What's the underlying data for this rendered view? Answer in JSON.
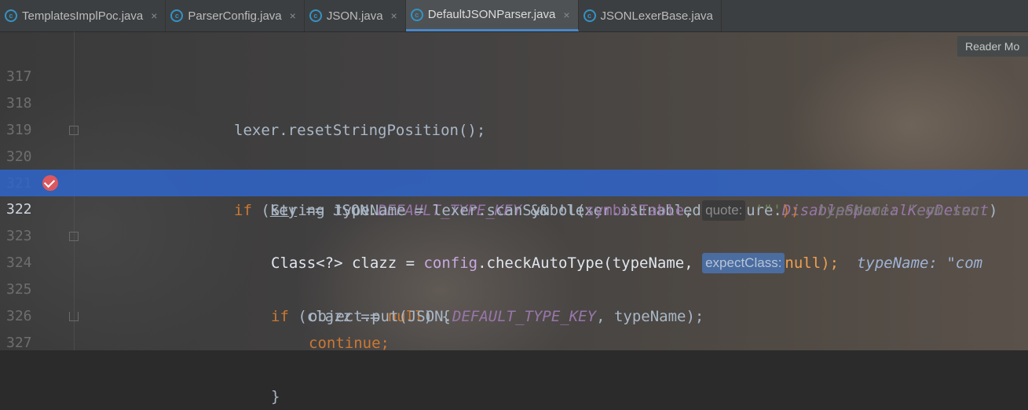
{
  "tabs": [
    {
      "label": "TemplatesImplPoc.java",
      "active": false,
      "close": "×"
    },
    {
      "label": "ParserConfig.java",
      "active": false,
      "close": "×"
    },
    {
      "label": "JSON.java",
      "active": false,
      "close": "×"
    },
    {
      "label": "DefaultJSONParser.java",
      "active": true,
      "close": "×"
    },
    {
      "label": "JSONLexerBase.java",
      "active": false,
      "close": ""
    }
  ],
  "tab_icon_letter": "c",
  "reader_mode": "Reader Mo",
  "colors": {
    "keyword": "#cc7832",
    "static_field": "#9876aa",
    "string": "#6a8759",
    "highlight": "#2f65ca",
    "breakpoint": "#db5860"
  },
  "lines": {
    "l317": {
      "num": "317"
    },
    "l318": {
      "num": "318",
      "text": "lexer.resetStringPosition();"
    },
    "l319": {
      "num": "319"
    },
    "l320": {
      "num": "320",
      "kw_if": "if",
      "paren": " (",
      "key": "key",
      "mid": " == JSON.",
      "const": "DEFAULT_TYPE_KEY",
      "mid2": " && !lexer.isEnabled(Feature.",
      "const2": "DisableSpecialKeyDetect",
      "end": ")"
    },
    "l321": {
      "num": "321",
      "pre": "String typeName = lexer.scanSymbol(",
      "field": "symbolTable",
      "comma": ", ",
      "hint": "quote:",
      "str": "'\"'",
      "end": ");",
      "debug": "typeName: \"com.sun."
    },
    "l322": {
      "num": "322",
      "pre": "Class<?> clazz = ",
      "field": "config",
      "mid": ".checkAutoType(typeName, ",
      "hint": "expectClass:",
      "kw_null": "null",
      "end": ");",
      "debug": "typeName: \"com"
    },
    "l323": {
      "num": "323"
    },
    "l324": {
      "num": "324",
      "kw_if": "if",
      "pre": " (clazz == ",
      "kw_null": "null",
      "end": ") {"
    },
    "l325": {
      "num": "325",
      "pre": "object.put(JSON.",
      "const": "DEFAULT_TYPE_KEY",
      "end": ", typeName);"
    },
    "l326": {
      "num": "326",
      "kw": "continue",
      "end": ";"
    },
    "l327": {
      "num": "327",
      "text": "}"
    }
  }
}
